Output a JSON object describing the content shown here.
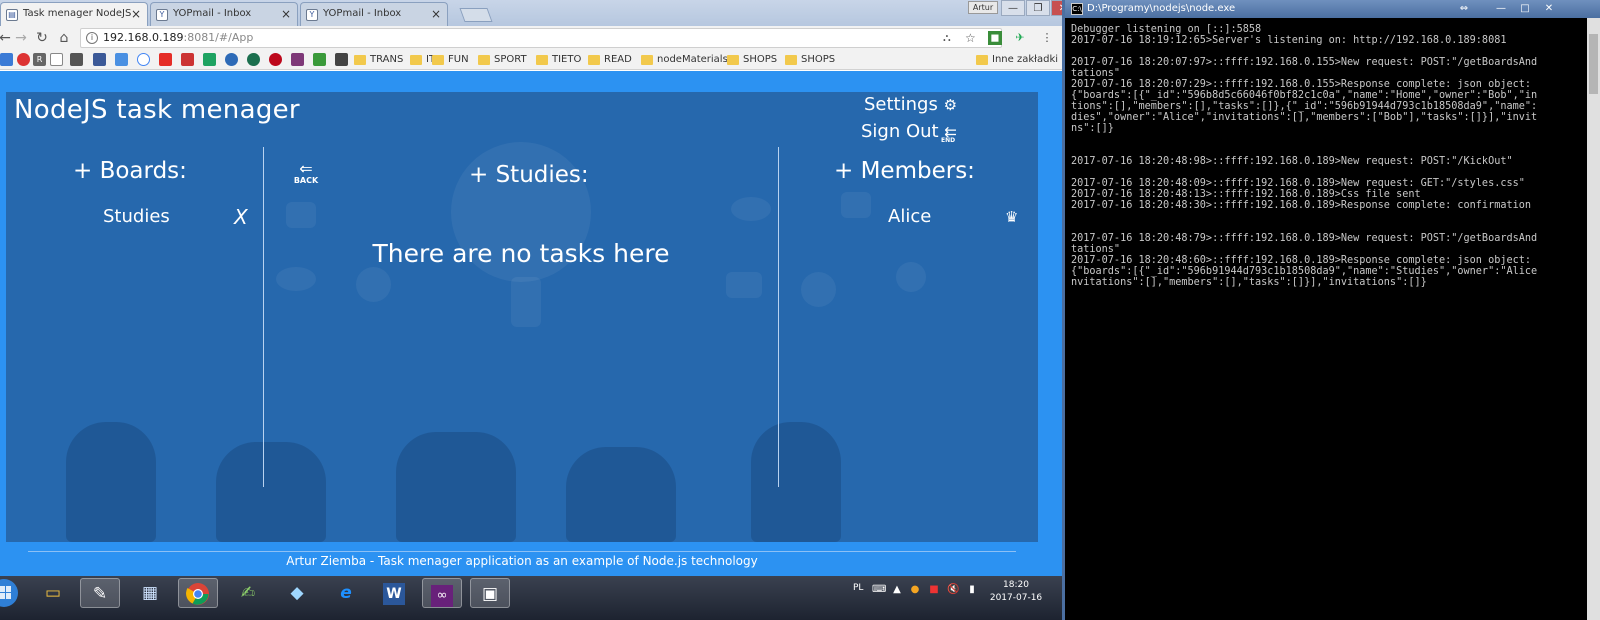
{
  "browser": {
    "tabs": [
      {
        "title": "Task menager NodeJS",
        "active": true
      },
      {
        "title": "YOPmail - Inbox",
        "active": false
      },
      {
        "title": "YOPmail - Inbox",
        "active": false
      }
    ],
    "profile_name": "Artur",
    "url_host": "192.168.0.189",
    "url_path": ":8081/#/App",
    "bookmarks": [
      "TRANS",
      "IT",
      "FUN",
      "SPORT",
      "TIETO",
      "READ",
      "nodeMaterials",
      "SHOPS",
      "SHOPS"
    ],
    "other_bookmarks": "Inne zakładki"
  },
  "app": {
    "title": "NodeJS task menager",
    "settings_label": "Settings",
    "signout_label": "Sign Out",
    "signout_icon_label": "END",
    "boards_title": "+ Boards:",
    "boards": [
      {
        "name": "Studies",
        "remove_label": "X"
      }
    ],
    "back_label": "BACK",
    "board_title": "+ Studies:",
    "empty_message": "There are no tasks here",
    "members_title": "+ Members:",
    "members": [
      {
        "name": "Alice",
        "owner": true
      }
    ],
    "footer": "Artur Ziemba - Task menager application as an example of Node.js technology"
  },
  "taskbar": {
    "language": "PL",
    "time": "18:20",
    "date": "2017-07-16"
  },
  "console": {
    "title": "D:\\Programy\\nodejs\\node.exe",
    "lines": [
      "Debugger listening on [::]:5858",
      "2017-07-16 18:19:12:65>Server's listening on: http://192.168.0.189:8081",
      "",
      "2017-07-16 18:20:07:97>::ffff:192.168.0.155>New request: POST:\"/getBoardsAnd",
      "tations\"",
      "2017-07-16 18:20:07:29>::ffff:192.168.0.155>Response complete: json object:",
      "{\"boards\":[{\"_id\":\"596b8d5c66046f0bf82c1c0a\",\"name\":\"Home\",\"owner\":\"Bob\",\"in",
      "tions\":[],\"members\":[],\"tasks\":[]},{\"_id\":\"596b91944d793c1b18508da9\",\"name\":",
      "dies\",\"owner\":\"Alice\",\"invitations\":[],\"members\":[\"Bob\"],\"tasks\":[]}],\"invit",
      "ns\":[]}",
      "",
      "",
      "2017-07-16 18:20:48:98>::ffff:192.168.0.189>New request: POST:\"/KickOut\"",
      "",
      "2017-07-16 18:20:48:09>::ffff:192.168.0.189>New request: GET:\"/styles.css\"",
      "2017-07-16 18:20:48:13>::ffff:192.168.0.189>Css file sent",
      "2017-07-16 18:20:48:30>::ffff:192.168.0.189>Response complete: confirmation",
      "",
      "",
      "2017-07-16 18:20:48:79>::ffff:192.168.0.189>New request: POST:\"/getBoardsAnd",
      "tations\"",
      "2017-07-16 18:20:48:60>::ffff:192.168.0.189>Response complete: json object:",
      "{\"boards\":[{\"_id\":\"596b91944d793c1b18508da9\",\"name\":\"Studies\",\"owner\":\"Alice",
      "nvitations\":[],\"members\":[],\"tasks\":[]}],\"invitations\":[]}"
    ]
  },
  "colors": {
    "page_bg": "#2c92f2",
    "panel_bg": "#2668ad",
    "console_bg": "#000000",
    "console_fg": "#c8c8c8"
  }
}
